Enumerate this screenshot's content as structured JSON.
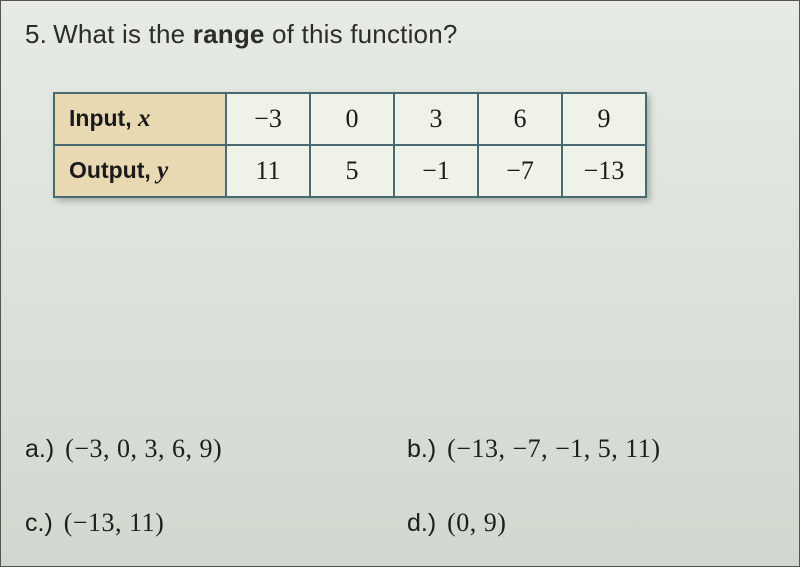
{
  "question": {
    "number": "5.",
    "pre": "What is the ",
    "bold": "range",
    "post": " of this function?"
  },
  "table": {
    "row1_label": "Input,",
    "row1_var": "x",
    "row1": [
      "−3",
      "0",
      "3",
      "6",
      "9"
    ],
    "row2_label": "Output,",
    "row2_var": "y",
    "row2": [
      "11",
      "5",
      "−1",
      "−7",
      "−13"
    ]
  },
  "opts": {
    "a_letter": "a.)",
    "a_val": "(−3, 0, 3, 6, 9)",
    "b_letter": "b.)",
    "b_val": "(−13, −7, −1, 5, 11)",
    "c_letter": "c.)",
    "c_val": "(−13, 11)",
    "d_letter": "d.)",
    "d_val": "(0, 9)"
  },
  "chart_data": {
    "type": "table",
    "columns": [
      "Input, x",
      "Output, y"
    ],
    "rows": [
      {
        "x": -3,
        "y": 11
      },
      {
        "x": 0,
        "y": 5
      },
      {
        "x": 3,
        "y": -1
      },
      {
        "x": 6,
        "y": -7
      },
      {
        "x": 9,
        "y": -13
      }
    ]
  }
}
